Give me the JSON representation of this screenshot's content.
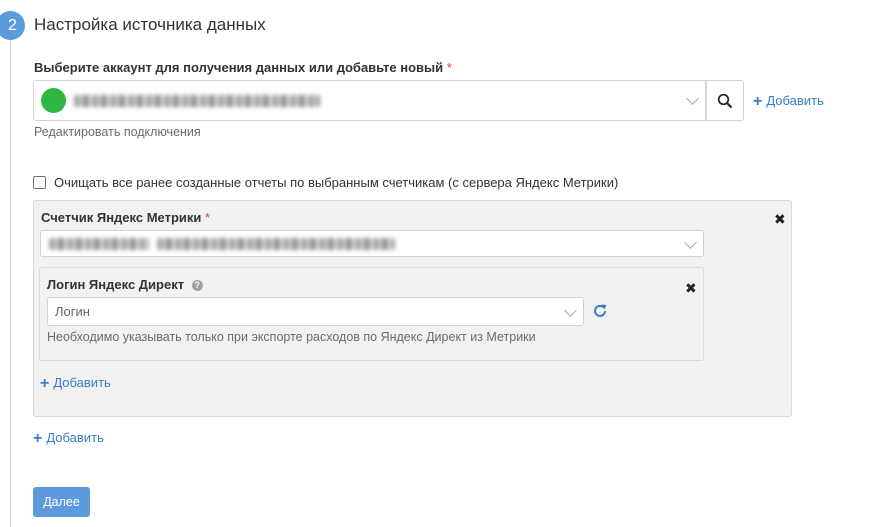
{
  "step": {
    "number": "2",
    "title": "Настройка источника данных"
  },
  "account": {
    "label": "Выберите аккаунт для получения данных или добавьте новый",
    "required_mark": "*",
    "selected_value_obscured": true,
    "status_color": "#2fb743",
    "add_label": "Добавить",
    "edit_link": "Редактировать подключения"
  },
  "clear_reports": {
    "checked": false,
    "label": "Очищать все ранее созданные отчеты по выбранным счетчикам (с сервера Яндекс Метрики)"
  },
  "counter": {
    "label": "Счетчик Яндекс Метрики",
    "required_mark": "*",
    "selected_value_obscured": true,
    "remove_icon": "✖",
    "direct_login": {
      "label": "Логин Яндекс Директ",
      "help_icon": "?",
      "placeholder": "Логин",
      "hint": "Необходимо указывать только при экспорте расходов по Яндекс Директ из Метрики",
      "remove_icon": "✖"
    },
    "add_login_label": "Добавить"
  },
  "add_counter_label": "Добавить",
  "next_button": "Далее",
  "colors": {
    "accent": "#5b9bdd",
    "link": "#3a7cc7",
    "required": "#e03d3d"
  }
}
